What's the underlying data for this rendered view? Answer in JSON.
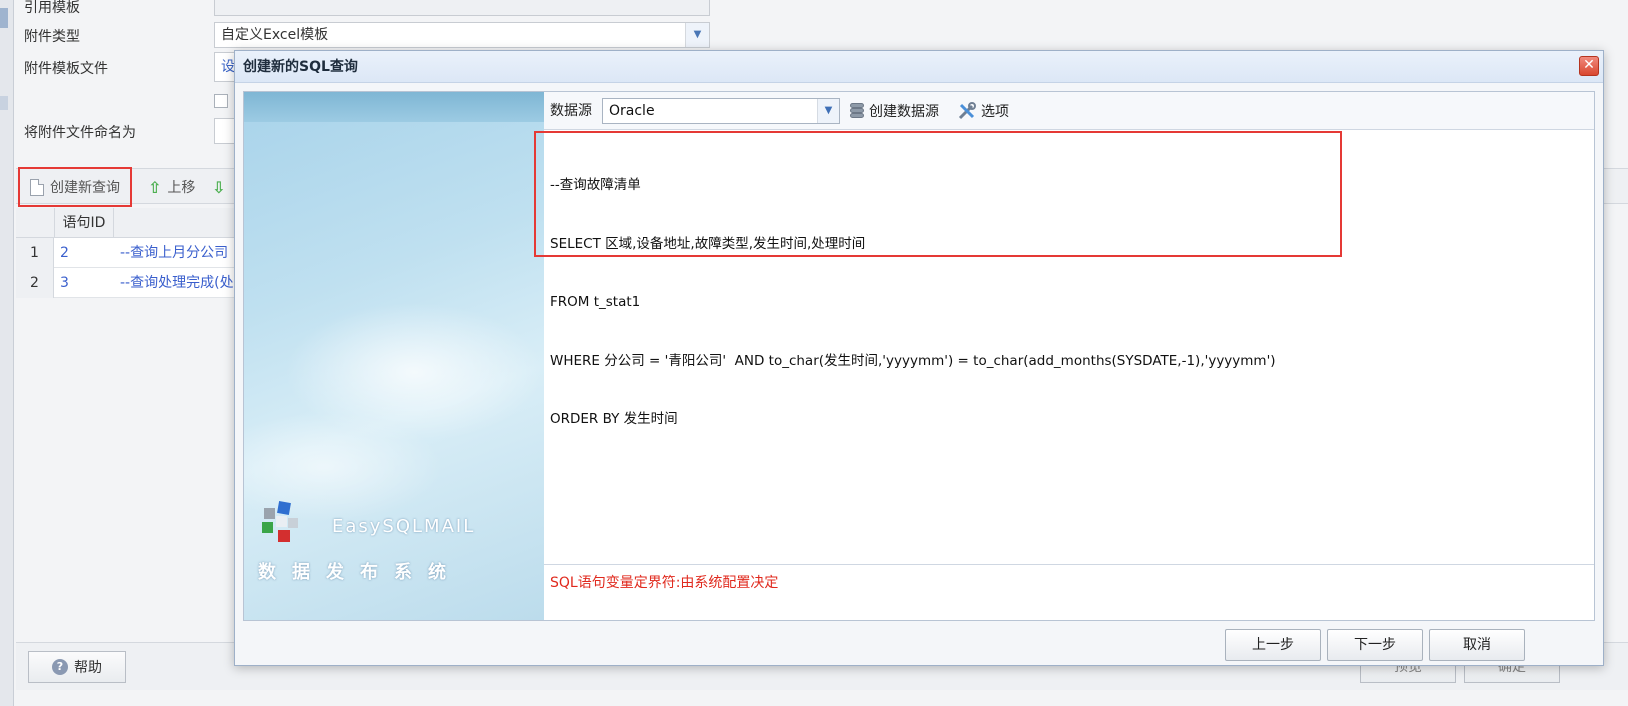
{
  "background": {
    "labels": {
      "ref_template": "引用模板",
      "attach_type": "附件类型",
      "attach_template_file": "附件模板文件",
      "rename_attach": "将附件文件命名为"
    },
    "attach_type_value": "自定义Excel模板",
    "template_file_value": "设",
    "toolbar": {
      "create_query": "创建新查询",
      "move_up": "上移"
    },
    "table": {
      "column_id": "语句ID",
      "rows": [
        {
          "num": "1",
          "id": "2",
          "sql": "--查询上月分公司"
        },
        {
          "num": "2",
          "id": "3",
          "sql": "--查询处理完成(处"
        }
      ]
    },
    "help_label": "帮助",
    "ghost_buttons": [
      "预览",
      "确定"
    ]
  },
  "dialog": {
    "title": "创建新的SQL查询",
    "close_glyph": "✕",
    "brand": {
      "name": "EasySQLMAIL",
      "subtitle": "数据发布系统"
    },
    "datasource": {
      "label": "数据源",
      "value": "Oracle",
      "create_label": "创建数据源",
      "options_label": "选项"
    },
    "sql_lines": [
      "--查询故障清单",
      "SELECT 区域,设备地址,故障类型,发生时间,处理时间",
      "FROM t_stat1",
      "WHERE 分公司 = '青阳公司'  AND to_char(发生时间,'yyyymm') = to_char(add_months(SYSDATE,-1),'yyyymm')",
      "ORDER BY 发生时间"
    ],
    "hint": "SQL语句变量定界符:由系统配置决定",
    "buttons": {
      "prev": "上一步",
      "next": "下一步",
      "cancel": "取消"
    }
  },
  "colors": {
    "highlight_red": "#e53935",
    "hint_red": "#e0291d",
    "link_blue": "#3a5fcd"
  }
}
